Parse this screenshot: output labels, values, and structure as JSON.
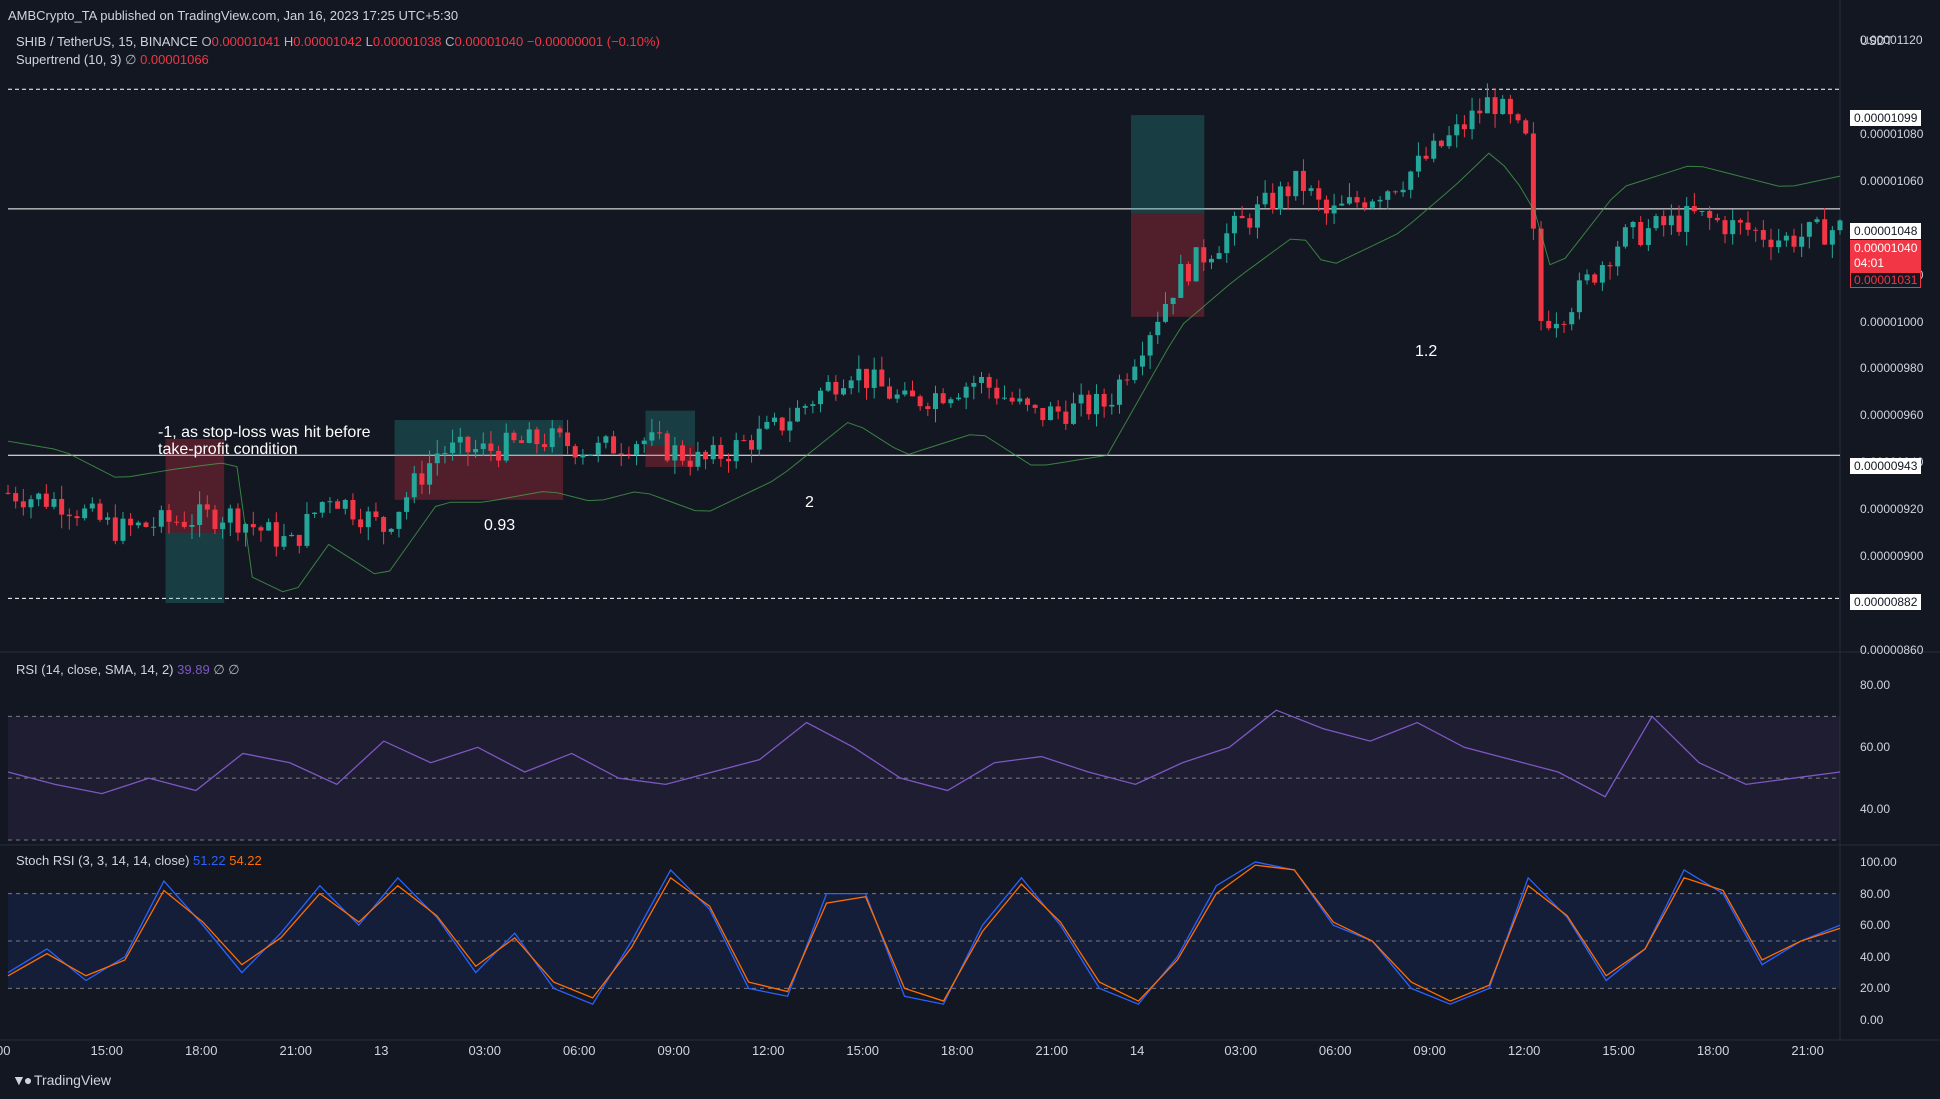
{
  "header": {
    "publisher": "AMBCrypto_TA published on TradingView.com, Jan 16, 2023 17:25 UTC+5:30"
  },
  "main_legend": {
    "symbol": "SHIB / TetherUS, 15, BINANCE",
    "o_label": "O",
    "o": "0.00001041",
    "h_label": "H",
    "h": "0.00001042",
    "l_label": "L",
    "l": "0.00001038",
    "c_label": "C",
    "c": "0.00001040",
    "change": "−0.00000001 (−0.10%)"
  },
  "supertrend_legend": {
    "name": "Supertrend (10, 3)",
    "symbol": "∅",
    "value": "0.00001066"
  },
  "rsi_legend": {
    "name": "RSI (14, close, SMA, 14, 2)",
    "value": "39.89",
    "extra": "∅ ∅"
  },
  "stoch_legend": {
    "name": "Stoch RSI (3, 3, 14, 14, close)",
    "k": "51.22",
    "d": "54.22"
  },
  "price_axis": {
    "unit": "USDT",
    "ticks": [
      "0.00001120",
      "0.00001080",
      "0.00001060",
      "0.00001020",
      "0.00001000",
      "0.00000980",
      "0.00000960",
      "0.00000940",
      "0.00000920",
      "0.00000900",
      "0.00000860"
    ],
    "tick_values": [
      11.2,
      10.8,
      10.6,
      10.2,
      10.0,
      9.8,
      9.6,
      9.4,
      9.2,
      9.0,
      8.6
    ]
  },
  "price_badges": {
    "level_1099": "0.00001099",
    "level_1048": "0.00001048",
    "current_price": "0.00001040",
    "countdown": "04:01",
    "supertrend_value": "0.00001031",
    "level_943": "0.00000943",
    "level_882": "0.00000882"
  },
  "rsi_axis": {
    "ticks": [
      "80.00",
      "60.00",
      "40.00"
    ]
  },
  "stoch_axis": {
    "ticks": [
      "100.00",
      "80.00",
      "60.00",
      "40.00",
      "20.00",
      "0.00"
    ]
  },
  "time_axis": {
    "ticks": [
      "00",
      "15:00",
      "18:00",
      "21:00",
      "13",
      "03:00",
      "06:00",
      "09:00",
      "12:00",
      "15:00",
      "18:00",
      "21:00",
      "14",
      "03:00",
      "06:00",
      "09:00",
      "12:00",
      "15:00",
      "18:00",
      "21:00"
    ]
  },
  "annotations": {
    "stop_loss_line1": "-1, as stop-loss was hit before",
    "stop_loss_line2": "take-profit condition",
    "trade_093": "0.93",
    "trade_2": "2",
    "trade_12": "1.2"
  },
  "footer": {
    "brand": "TradingView"
  },
  "colors": {
    "background": "#131722",
    "up": "#26a69a",
    "down": "#f23645",
    "rsi_line": "#7e57c2",
    "stoch_k": "#2962ff",
    "stoch_d": "#ff6d00",
    "supertrend_up": "#4caf50",
    "supertrend_down": "#f23645"
  },
  "chart_data": [
    {
      "type": "candlestick",
      "title": "SHIB / TetherUS, 15, BINANCE",
      "unit": "USDT",
      "ylim": [
        8.6e-06,
        1.12e-05
      ],
      "horizontal_levels": [
        1.099e-05,
        1.048e-05,
        9.43e-06,
        8.82e-06
      ],
      "close_path": [
        {
          "t": 0.0,
          "p": 9.27
        },
        {
          "t": 0.03,
          "p": 9.23
        },
        {
          "t": 0.06,
          "p": 9.11
        },
        {
          "t": 0.09,
          "p": 9.15
        },
        {
          "t": 0.12,
          "p": 9.18
        },
        {
          "t": 0.155,
          "p": 9.05
        },
        {
          "t": 0.175,
          "p": 9.27
        },
        {
          "t": 0.205,
          "p": 9.12
        },
        {
          "t": 0.235,
          "p": 9.45
        },
        {
          "t": 0.26,
          "p": 9.45
        },
        {
          "t": 0.295,
          "p": 9.5
        },
        {
          "t": 0.32,
          "p": 9.45
        },
        {
          "t": 0.345,
          "p": 9.5
        },
        {
          "t": 0.38,
          "p": 9.4
        },
        {
          "t": 0.42,
          "p": 9.55
        },
        {
          "t": 0.46,
          "p": 9.8
        },
        {
          "t": 0.49,
          "p": 9.65
        },
        {
          "t": 0.53,
          "p": 9.75
        },
        {
          "t": 0.56,
          "p": 9.6
        },
        {
          "t": 0.6,
          "p": 9.65
        },
        {
          "t": 0.64,
          "p": 10.2
        },
        {
          "t": 0.67,
          "p": 10.4
        },
        {
          "t": 0.705,
          "p": 10.6
        },
        {
          "t": 0.72,
          "p": 10.45
        },
        {
          "t": 0.76,
          "p": 10.6
        },
        {
          "t": 0.79,
          "p": 10.8
        },
        {
          "t": 0.81,
          "p": 10.95
        },
        {
          "t": 0.83,
          "p": 10.75
        },
        {
          "t": 0.835,
          "p": 10.0
        },
        {
          "t": 0.85,
          "p": 10.05
        },
        {
          "t": 0.88,
          "p": 10.35
        },
        {
          "t": 0.92,
          "p": 10.45
        },
        {
          "t": 0.97,
          "p": 10.35
        },
        {
          "t": 1.0,
          "p": 10.4
        }
      ]
    },
    {
      "type": "line",
      "title": "RSI (14, close, SMA, 14, 2)",
      "ylim": [
        30,
        85
      ],
      "bands": [
        30,
        50,
        70
      ],
      "series": [
        {
          "values": [
            52,
            48,
            45,
            50,
            46,
            58,
            55,
            48,
            62,
            55,
            60,
            52,
            58,
            50,
            48,
            52,
            56,
            68,
            60,
            50,
            46,
            55,
            57,
            52,
            48,
            55,
            60,
            72,
            66,
            62,
            68,
            60,
            56,
            52,
            44,
            70,
            55,
            48,
            50,
            52
          ]
        }
      ]
    },
    {
      "type": "line",
      "title": "Stoch RSI (3, 3, 14, 14, close)",
      "ylim": [
        0,
        100
      ],
      "bands": [
        20,
        50,
        80
      ],
      "series": [
        {
          "values": [
            30,
            45,
            25,
            40,
            88,
            60,
            30,
            55,
            85,
            60,
            90,
            65,
            30,
            55,
            20,
            10,
            50,
            95,
            70,
            20,
            15,
            80,
            80,
            15,
            10,
            60,
            90,
            60,
            20,
            10,
            40,
            85,
            100,
            95,
            60,
            50,
            20,
            10,
            20,
            90,
            65,
            25,
            45,
            95,
            80,
            35,
            50,
            60
          ]
        },
        {
          "values": [
            28,
            42,
            28,
            38,
            82,
            62,
            35,
            52,
            80,
            62,
            85,
            66,
            34,
            52,
            24,
            14,
            46,
            90,
            72,
            24,
            18,
            74,
            78,
            20,
            12,
            56,
            86,
            62,
            24,
            12,
            38,
            80,
            98,
            95,
            62,
            50,
            24,
            12,
            22,
            85,
            66,
            28,
            45,
            90,
            82,
            38,
            50,
            58
          ]
        }
      ]
    }
  ]
}
